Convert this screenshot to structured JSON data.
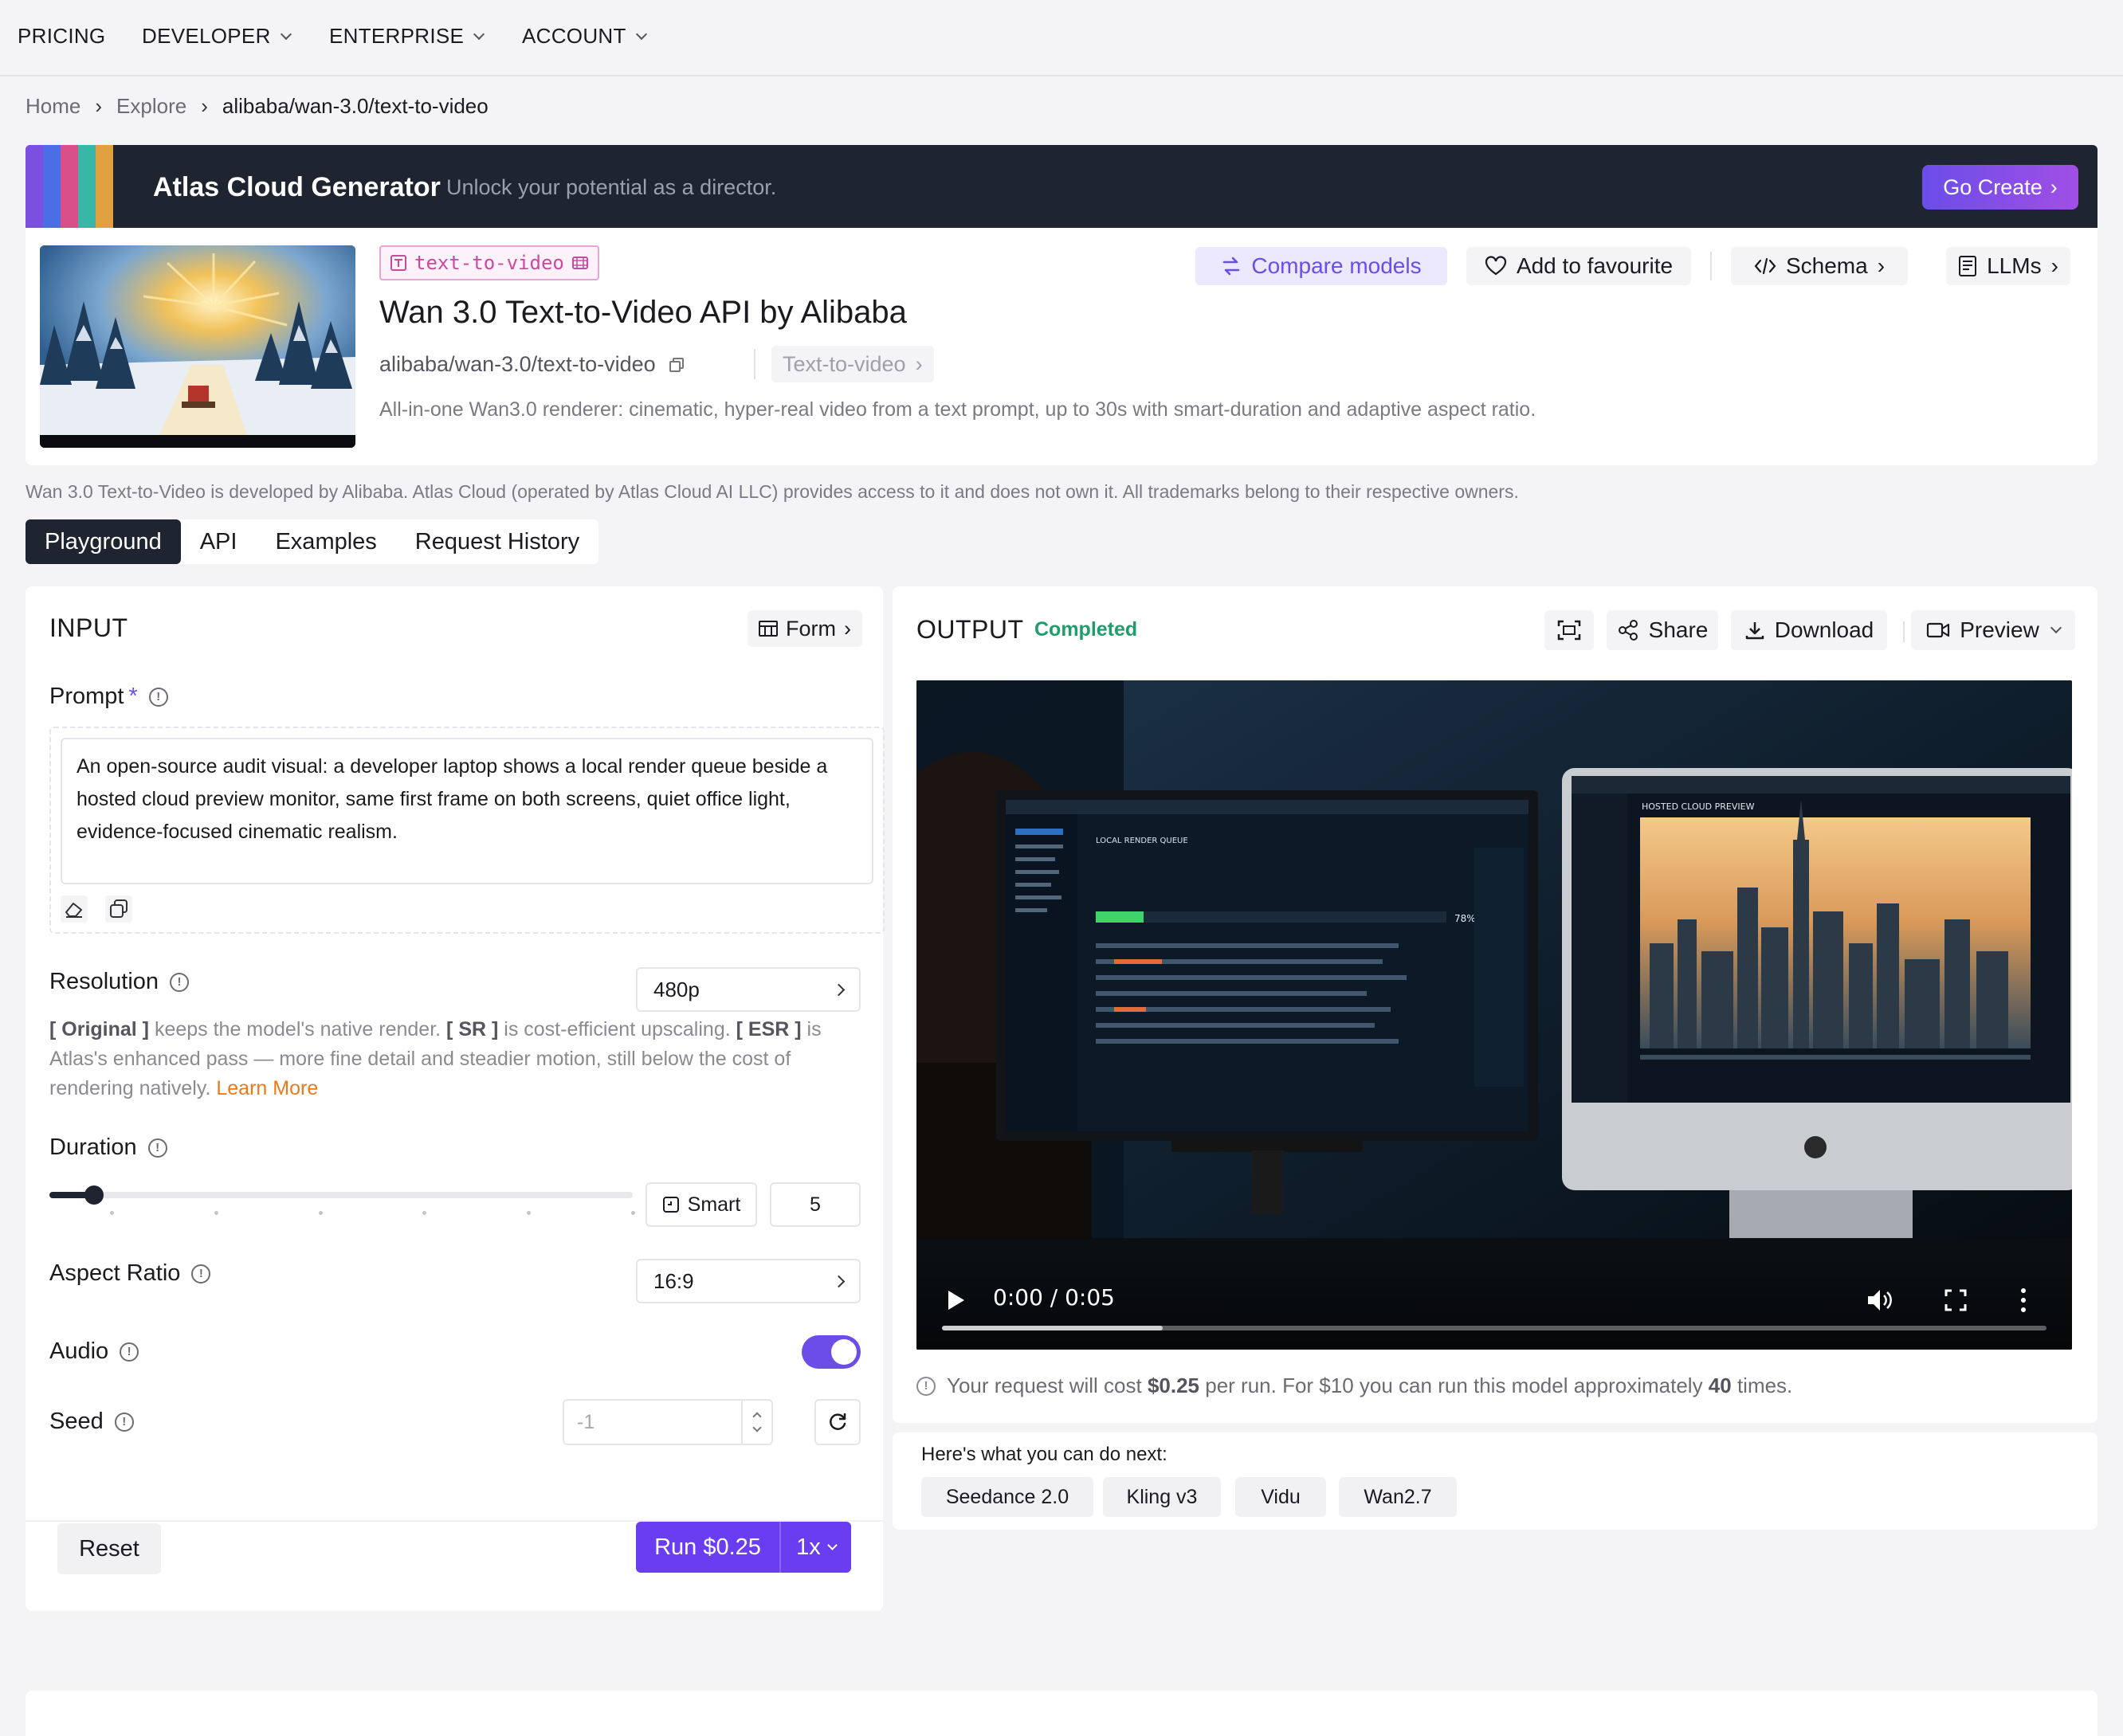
{
  "nav": {
    "items": [
      {
        "label": "PRICING",
        "has_menu": false
      },
      {
        "label": "DEVELOPER",
        "has_menu": true
      },
      {
        "label": "ENTERPRISE",
        "has_menu": true
      },
      {
        "label": "ACCOUNT",
        "has_menu": true
      }
    ]
  },
  "breadcrumb": {
    "home": "Home",
    "explore": "Explore",
    "current": "alibaba/wan-3.0/text-to-video",
    "sep": "›"
  },
  "banner": {
    "title": "Atlas Cloud Generator",
    "subtitle": "Unlock your potential as a director.",
    "cta": "Go Create",
    "cta_arrow": "›",
    "stripe_colors": [
      "#7b4fe0",
      "#4b6ee6",
      "#d94f8a",
      "#38b6a6",
      "#e0a040"
    ]
  },
  "model": {
    "tag": "text-to-video",
    "title": "Wan 3.0 Text-to-Video API by Alibaba",
    "id": "alibaba/wan-3.0/text-to-video",
    "category": "Text-to-video",
    "category_arrow": "›",
    "description": "All-in-one Wan3.0 renderer: cinematic, hyper-real video from a text prompt, up to 30s with smart-duration and adaptive aspect ratio.",
    "actions": {
      "compare": "Compare models",
      "favourite": "Add to favourite",
      "schema": "Schema",
      "llms": "LLMs",
      "arrow": "›"
    }
  },
  "disclaimer": "Wan 3.0 Text-to-Video is developed by Alibaba. Atlas Cloud (operated by Atlas Cloud AI LLC) provides access to it and does not own it. All trademarks belong to their respective owners.",
  "tabs": [
    {
      "label": "Playground",
      "active": true
    },
    {
      "label": "API",
      "active": false
    },
    {
      "label": "Examples",
      "active": false
    },
    {
      "label": "Request History",
      "active": false
    }
  ],
  "input": {
    "title": "INPUT",
    "form_btn": "Form",
    "form_arrow": "›",
    "prompt_label": "Prompt",
    "required_mark": "*",
    "prompt_value": "An open-source audit visual: a developer laptop shows a local render queue beside a hosted cloud preview monitor, same first frame on both screens, quiet office light, evidence-focused cinematic realism.",
    "resolution_label": "Resolution",
    "resolution_value": "480p",
    "help": {
      "original": "[ Original ]",
      "t1": " keeps the model's native render. ",
      "sr": "[ SR ]",
      "t2": " is cost-efficient upscaling. ",
      "esr": "[ ESR ]",
      "t3": " is Atlas's enhanced pass — more fine detail and steadier motion, still below the cost of rendering natively. ",
      "learn_more": "Learn More"
    },
    "duration_label": "Duration",
    "duration_value": "5",
    "duration_fraction": 0.06,
    "smart_label": "Smart",
    "aspect_label": "Aspect Ratio",
    "aspect_value": "16:9",
    "audio_label": "Audio",
    "audio_on": true,
    "seed_label": "Seed",
    "seed_placeholder": "-1",
    "reset": "Reset",
    "run": "Run $0.25",
    "multiplier": "1x",
    "info_glyph": "!"
  },
  "output": {
    "title": "OUTPUT",
    "status": "Completed",
    "share": "Share",
    "download": "Download",
    "preview": "Preview",
    "time": "0:00 / 0:05",
    "buffered_fraction": 0.2,
    "cost": {
      "prefix": "Your request will cost ",
      "price": "$0.25",
      "mid": " per run. For $10 you can run this model approximately ",
      "count": "40",
      "suffix": " times."
    },
    "screen": {
      "left_header": "LOCAL RENDER QUEUE",
      "percent": "78%",
      "right_header": "HOSTED CLOUD PREVIEW"
    }
  },
  "next": {
    "title": "Here's what you can do next:",
    "chips": [
      "Seedance 2.0",
      "Kling v3",
      "Vidu",
      "Wan2.7"
    ]
  },
  "colors": {
    "accent": "#6b4de8",
    "success": "#1f9d6b",
    "dark": "#1e2430",
    "link": "#e97b1a"
  }
}
